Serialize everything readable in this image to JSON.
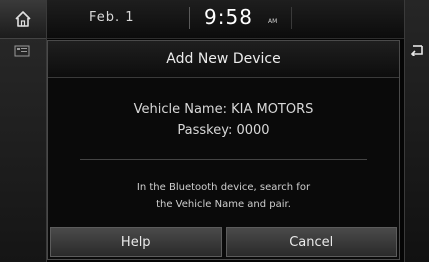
{
  "status_bar": {
    "date": "Feb.  1",
    "time": "9:58",
    "ampm": "AM"
  },
  "icons": {
    "home": "home-icon",
    "side": "media-icon",
    "back": "back-arrow-icon"
  },
  "dialog": {
    "title": "Add New Device",
    "vehicle_line": "Vehicle Name: KIA MOTORS",
    "passkey_line": "Passkey: 0000",
    "instruction_line1": "In the Bluetooth device, search for",
    "instruction_line2": "the Vehicle Name and pair.",
    "help_label": "Help",
    "cancel_label": "Cancel"
  }
}
